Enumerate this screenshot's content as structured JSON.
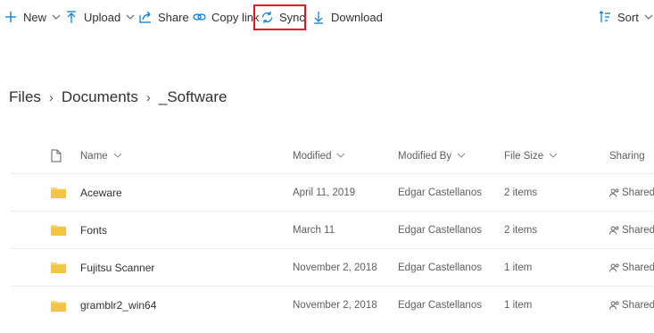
{
  "toolbar": {
    "new_label": "New",
    "upload_label": "Upload",
    "share_label": "Share",
    "copy_link_label": "Copy link",
    "sync_label": "Sync",
    "download_label": "Download",
    "sort_label": "Sort"
  },
  "breadcrumb": {
    "items": [
      "Files",
      "Documents",
      "_Software"
    ]
  },
  "table": {
    "headers": {
      "name": "Name",
      "modified": "Modified",
      "modified_by": "Modified By",
      "file_size": "File Size",
      "sharing": "Sharing"
    },
    "rows": [
      {
        "name": "Aceware",
        "modified": "April 11, 2019",
        "modified_by": "Edgar Castellanos",
        "file_size": "2 items",
        "sharing": "Shared"
      },
      {
        "name": "Fonts",
        "modified": "March 11",
        "modified_by": "Edgar Castellanos",
        "file_size": "2 items",
        "sharing": "Shared"
      },
      {
        "name": "Fujitsu Scanner",
        "modified": "November 2, 2018",
        "modified_by": "Edgar Castellanos",
        "file_size": "1 item",
        "sharing": "Shared"
      },
      {
        "name": "gramblr2_win64",
        "modified": "November 2, 2018",
        "modified_by": "Edgar Castellanos",
        "file_size": "1 item",
        "sharing": "Shared"
      }
    ]
  },
  "colors": {
    "accent": "#0078d4",
    "highlight_border": "#e81123",
    "folder": "#f8d775"
  },
  "icons": {
    "new": "plus-icon",
    "upload": "upload-arrow-icon",
    "share": "share-icon",
    "copy_link": "link-icon",
    "sync": "sync-icon",
    "download": "download-arrow-icon",
    "sort": "sort-icon",
    "file_type": "document-icon",
    "folder": "folder-icon",
    "sharing": "people-icon"
  }
}
